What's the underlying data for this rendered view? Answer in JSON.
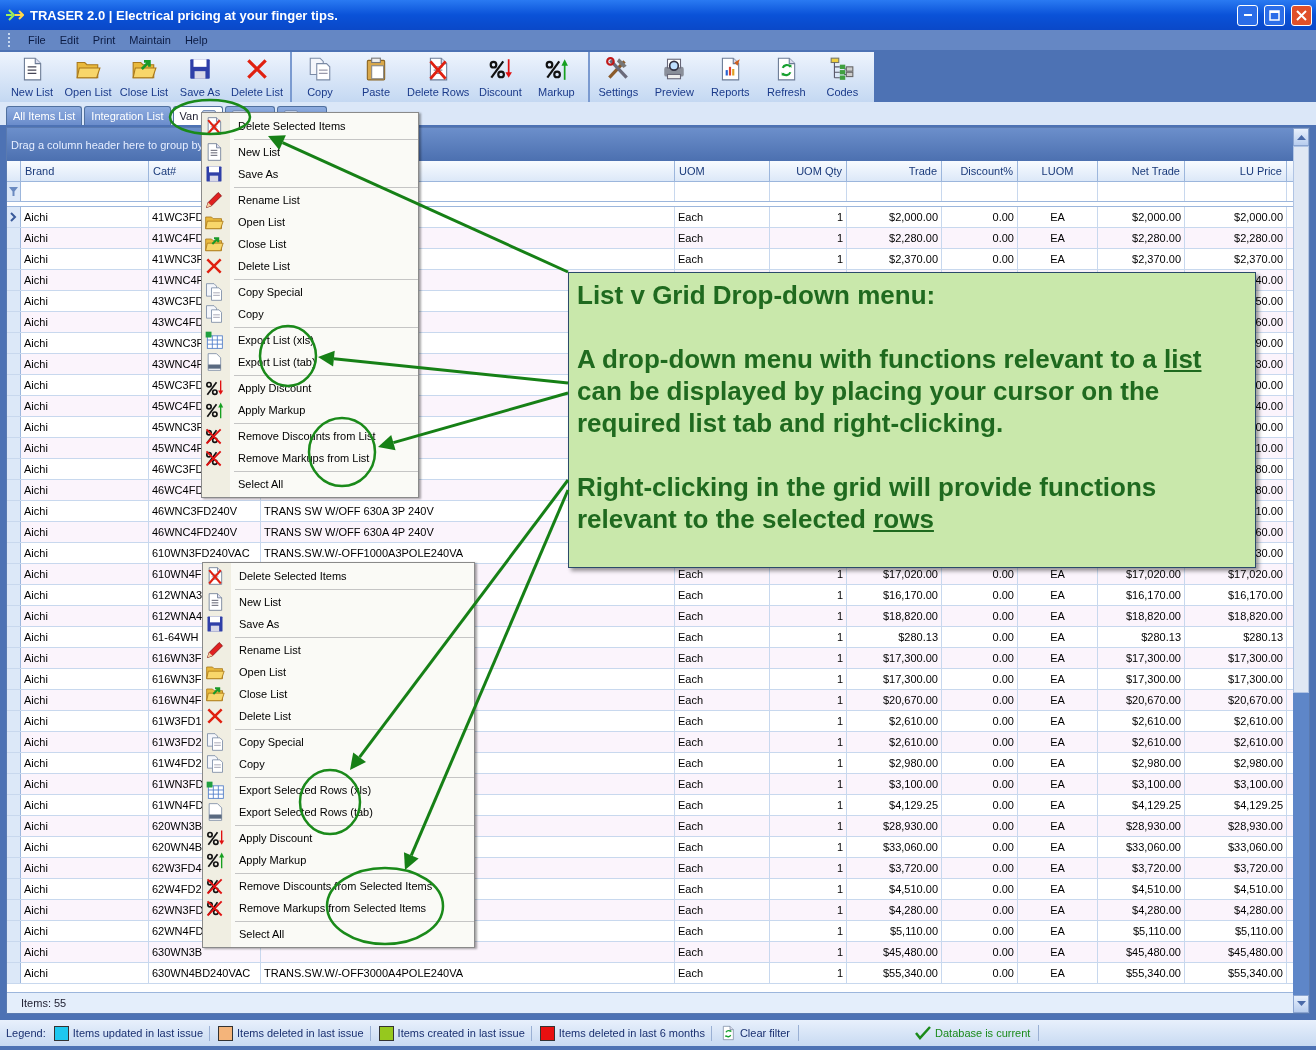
{
  "window": {
    "title": "TRASER 2.0 | Electrical pricing at your finger tips."
  },
  "menu_bar": [
    "File",
    "Edit",
    "Print",
    "Maintain",
    "Help"
  ],
  "toolbar": {
    "groups": [
      [
        {
          "label": "New List",
          "kind": "new"
        },
        {
          "label": "Open List",
          "kind": "open"
        },
        {
          "label": "Close List",
          "kind": "close"
        },
        {
          "label": "Save As",
          "kind": "save"
        },
        {
          "label": "Delete List",
          "kind": "delete"
        }
      ],
      [
        {
          "label": "Copy",
          "kind": "copy"
        },
        {
          "label": "Paste",
          "kind": "paste"
        },
        {
          "label": "Delete Rows",
          "kind": "delete-rows"
        },
        {
          "label": "Discount",
          "kind": "discount"
        },
        {
          "label": "Markup",
          "kind": "markup"
        }
      ],
      [
        {
          "label": "Settings",
          "kind": "settings"
        },
        {
          "label": "Preview",
          "kind": "preview"
        },
        {
          "label": "Reports",
          "kind": "reports"
        },
        {
          "label": "Refresh",
          "kind": "refresh"
        },
        {
          "label": "Codes",
          "kind": "codes"
        }
      ]
    ]
  },
  "tabs": [
    {
      "label": "All Items List",
      "selected": false,
      "closable": false
    },
    {
      "label": "Integration List",
      "selected": false,
      "closable": false
    },
    {
      "label": "Van",
      "selected": true,
      "closable": true
    },
    {
      "selected": false,
      "closable": true
    },
    {
      "selected": false,
      "closable": true
    }
  ],
  "grid": {
    "group_by_hint": "Drag a column header here to group by",
    "columns": [
      {
        "label": "Brand"
      },
      {
        "label": "Cat#"
      },
      {},
      {
        "label": "UOM"
      },
      {
        "label": "UOM Qty"
      },
      {
        "label": "Trade"
      },
      {
        "label": "Discount%"
      },
      {
        "label": "LUOM"
      },
      {
        "label": "Net Trade"
      },
      {
        "label": "LU Price"
      }
    ],
    "rows": [
      {
        "current": true,
        "brand": "Aichi",
        "cat_no": "41WC3FD",
        "uom": "Each",
        "uom_qty": "1",
        "trade": "$2,000.00",
        "discount_pct": "0.00",
        "luom": "EA",
        "net_trade": "$2,000.00",
        "lu_price": "$2,000.00"
      },
      {
        "current": false,
        "brand": "Aichi",
        "cat_no": "41WC4FD",
        "uom": "Each",
        "uom_qty": "1",
        "trade": "$2,280.00",
        "discount_pct": "0.00",
        "luom": "EA",
        "net_trade": "$2,280.00",
        "lu_price": "$2,280.00"
      },
      {
        "current": false,
        "brand": "Aichi",
        "cat_no": "41WNC3F",
        "uom": "Each",
        "uom_qty": "1",
        "trade": "$2,370.00",
        "discount_pct": "0.00",
        "luom": "EA",
        "net_trade": "$2,370.00",
        "lu_price": "$2,370.00"
      },
      {
        "current": false,
        "brand": "Aichi",
        "cat_no": "41WNC4F",
        "lu_price": "40.00"
      },
      {
        "current": false,
        "brand": "Aichi",
        "cat_no": "43WC3FD",
        "lu_price": "50.00"
      },
      {
        "current": false,
        "brand": "Aichi",
        "cat_no": "43WC4FD",
        "lu_price": "60.00"
      },
      {
        "current": false,
        "brand": "Aichi",
        "cat_no": "43WNC3F",
        "lu_price": "90.00"
      },
      {
        "current": false,
        "brand": "Aichi",
        "cat_no": "43WNC4F",
        "lu_price": "30.00"
      },
      {
        "current": false,
        "brand": "Aichi",
        "cat_no": "45WC3FD",
        "lu_price": "00.00"
      },
      {
        "current": false,
        "brand": "Aichi",
        "cat_no": "45WC4FD",
        "lu_price": "40.00"
      },
      {
        "current": false,
        "brand": "Aichi",
        "cat_no": "45WNC3F",
        "lu_price": "00.00"
      },
      {
        "current": false,
        "brand": "Aichi",
        "cat_no": "45WNC4F",
        "lu_price": "10.00"
      },
      {
        "current": false,
        "brand": "Aichi",
        "cat_no": "46WC3FD",
        "lu_price": "80.00"
      },
      {
        "current": false,
        "brand": "Aichi",
        "cat_no": "46WC4FD",
        "lu_price": "80.00"
      },
      {
        "current": false,
        "brand": "Aichi",
        "cat_no": "46WNC3FD240V",
        "column_3": "TRANS SW W/OFF 630A 3P 240V",
        "lu_price": "10.00"
      },
      {
        "current": false,
        "brand": "Aichi",
        "cat_no": "46WNC4FD240V",
        "column_3": "TRANS SW W/OFF 630A 4P 240V",
        "lu_price": "60.00"
      },
      {
        "current": false,
        "brand": "Aichi",
        "cat_no": "610WN3FD240VAC",
        "column_3": "TRANS.SW.W/-OFF1000A3POLE240VA",
        "lu_price": "30.00"
      },
      {
        "current": false,
        "brand": "Aichi",
        "cat_no": "610WN4F",
        "uom": "Each",
        "uom_qty": "1",
        "trade": "$17,020.00",
        "discount_pct": "0.00",
        "luom": "EA",
        "net_trade": "$17,020.00",
        "lu_price": "$17,020.00"
      },
      {
        "current": false,
        "brand": "Aichi",
        "cat_no": "612WNA3",
        "uom": "Each",
        "uom_qty": "1",
        "trade": "$16,170.00",
        "discount_pct": "0.00",
        "luom": "EA",
        "net_trade": "$16,170.00",
        "lu_price": "$16,170.00"
      },
      {
        "current": false,
        "brand": "Aichi",
        "cat_no": "612WNA4",
        "uom": "Each",
        "uom_qty": "1",
        "trade": "$18,820.00",
        "discount_pct": "0.00",
        "luom": "EA",
        "net_trade": "$18,820.00",
        "lu_price": "$18,820.00"
      },
      {
        "current": false,
        "brand": "Aichi",
        "cat_no": "61-64WH",
        "uom": "Each",
        "uom_qty": "1",
        "trade": "$280.13",
        "discount_pct": "0.00",
        "luom": "EA",
        "net_trade": "$280.13",
        "lu_price": "$280.13"
      },
      {
        "current": false,
        "brand": "Aichi",
        "cat_no": "616WN3F",
        "uom": "Each",
        "uom_qty": "1",
        "trade": "$17,300.00",
        "discount_pct": "0.00",
        "luom": "EA",
        "net_trade": "$17,300.00",
        "lu_price": "$17,300.00"
      },
      {
        "current": false,
        "brand": "Aichi",
        "cat_no": "616WN3F",
        "uom": "Each",
        "uom_qty": "1",
        "trade": "$17,300.00",
        "discount_pct": "0.00",
        "luom": "EA",
        "net_trade": "$17,300.00",
        "lu_price": "$17,300.00"
      },
      {
        "current": false,
        "brand": "Aichi",
        "cat_no": "616WN4F",
        "uom": "Each",
        "uom_qty": "1",
        "trade": "$20,670.00",
        "discount_pct": "0.00",
        "luom": "EA",
        "net_trade": "$20,670.00",
        "lu_price": "$20,670.00"
      },
      {
        "current": false,
        "brand": "Aichi",
        "cat_no": "61W3FD1",
        "uom": "Each",
        "uom_qty": "1",
        "trade": "$2,610.00",
        "discount_pct": "0.00",
        "luom": "EA",
        "net_trade": "$2,610.00",
        "lu_price": "$2,610.00"
      },
      {
        "current": false,
        "brand": "Aichi",
        "cat_no": "61W3FD2",
        "uom": "Each",
        "uom_qty": "1",
        "trade": "$2,610.00",
        "discount_pct": "0.00",
        "luom": "EA",
        "net_trade": "$2,610.00",
        "lu_price": "$2,610.00"
      },
      {
        "current": false,
        "brand": "Aichi",
        "cat_no": "61W4FD2",
        "uom": "Each",
        "uom_qty": "1",
        "trade": "$2,980.00",
        "discount_pct": "0.00",
        "luom": "EA",
        "net_trade": "$2,980.00",
        "lu_price": "$2,980.00"
      },
      {
        "current": false,
        "brand": "Aichi",
        "cat_no": "61WN3FD",
        "uom": "Each",
        "uom_qty": "1",
        "trade": "$3,100.00",
        "discount_pct": "0.00",
        "luom": "EA",
        "net_trade": "$3,100.00",
        "lu_price": "$3,100.00"
      },
      {
        "current": false,
        "brand": "Aichi",
        "cat_no": "61WN4FD",
        "uom": "Each",
        "uom_qty": "1",
        "trade": "$4,129.25",
        "discount_pct": "0.00",
        "luom": "EA",
        "net_trade": "$4,129.25",
        "lu_price": "$4,129.25"
      },
      {
        "current": false,
        "brand": "Aichi",
        "cat_no": "620WN3B",
        "uom": "Each",
        "uom_qty": "1",
        "trade": "$28,930.00",
        "discount_pct": "0.00",
        "luom": "EA",
        "net_trade": "$28,930.00",
        "lu_price": "$28,930.00"
      },
      {
        "current": false,
        "brand": "Aichi",
        "cat_no": "620WN4B",
        "uom": "Each",
        "uom_qty": "1",
        "trade": "$33,060.00",
        "discount_pct": "0.00",
        "luom": "EA",
        "net_trade": "$33,060.00",
        "lu_price": "$33,060.00"
      },
      {
        "current": false,
        "brand": "Aichi",
        "cat_no": "62W3FD4",
        "uom": "Each",
        "uom_qty": "1",
        "trade": "$3,720.00",
        "discount_pct": "0.00",
        "luom": "EA",
        "net_trade": "$3,720.00",
        "lu_price": "$3,720.00"
      },
      {
        "current": false,
        "brand": "Aichi",
        "cat_no": "62W4FD2",
        "uom": "Each",
        "uom_qty": "1",
        "trade": "$4,510.00",
        "discount_pct": "0.00",
        "luom": "EA",
        "net_trade": "$4,510.00",
        "lu_price": "$4,510.00"
      },
      {
        "current": false,
        "brand": "Aichi",
        "cat_no": "62WN3FD",
        "uom": "Each",
        "uom_qty": "1",
        "trade": "$4,280.00",
        "discount_pct": "0.00",
        "luom": "EA",
        "net_trade": "$4,280.00",
        "lu_price": "$4,280.00"
      },
      {
        "current": false,
        "brand": "Aichi",
        "cat_no": "62WN4FD",
        "uom": "Each",
        "uom_qty": "1",
        "trade": "$5,110.00",
        "discount_pct": "0.00",
        "luom": "EA",
        "net_trade": "$5,110.00",
        "lu_price": "$5,110.00"
      },
      {
        "current": false,
        "brand": "Aichi",
        "cat_no": "630WN3B",
        "uom": "Each",
        "uom_qty": "1",
        "trade": "$45,480.00",
        "discount_pct": "0.00",
        "luom": "EA",
        "net_trade": "$45,480.00",
        "lu_price": "$45,480.00"
      },
      {
        "current": false,
        "brand": "Aichi",
        "cat_no": "630WN4BD240VAC",
        "column_3": "TRANS.SW.W/-OFF3000A4POLE240VA",
        "uom": "Each",
        "uom_qty": "1",
        "trade": "$55,340.00",
        "discount_pct": "0.00",
        "luom": "EA",
        "net_trade": "$55,340.00",
        "lu_price": "$55,340.00"
      }
    ],
    "footer": "Items: 55"
  },
  "list_menu": [
    {
      "kind": "delete-items",
      "label": "Delete Selected Items"
    },
    {
      "kind": "separator"
    },
    {
      "kind": "new",
      "label": "New List"
    },
    {
      "kind": "save",
      "label": "Save As"
    },
    {
      "kind": "separator"
    },
    {
      "kind": "rename",
      "label": "Rename List"
    },
    {
      "kind": "open",
      "label": "Open List"
    },
    {
      "kind": "close",
      "label": "Close List"
    },
    {
      "kind": "delete",
      "label": "Delete List"
    },
    {
      "kind": "separator"
    },
    {
      "kind": "copy",
      "label": "Copy Special"
    },
    {
      "kind": "copy",
      "label": "Copy"
    },
    {
      "kind": "separator"
    },
    {
      "kind": "export-xls",
      "label": "Export List (xls)"
    },
    {
      "kind": "export-tab",
      "label": "Export List (tab)"
    },
    {
      "kind": "separator"
    },
    {
      "kind": "discount",
      "label": "Apply Discount"
    },
    {
      "kind": "markup",
      "label": "Apply Markup"
    },
    {
      "kind": "separator"
    },
    {
      "kind": "remove-discount",
      "label": "Remove Discounts from List"
    },
    {
      "kind": "remove-markup",
      "label": "Remove Markups from List"
    },
    {
      "kind": "separator"
    },
    {
      "kind": "plain",
      "label": "Select All"
    }
  ],
  "grid_menu": [
    {
      "kind": "delete-items",
      "label": "Delete Selected Items"
    },
    {
      "kind": "separator"
    },
    {
      "kind": "new",
      "label": "New List"
    },
    {
      "kind": "save",
      "label": "Save As"
    },
    {
      "kind": "separator"
    },
    {
      "kind": "rename",
      "label": "Rename List"
    },
    {
      "kind": "open",
      "label": "Open List"
    },
    {
      "kind": "close",
      "label": "Close List"
    },
    {
      "kind": "delete",
      "label": "Delete List"
    },
    {
      "kind": "separator"
    },
    {
      "kind": "copy",
      "label": "Copy Special"
    },
    {
      "kind": "copy",
      "label": "Copy"
    },
    {
      "kind": "separator"
    },
    {
      "kind": "export-xls",
      "label": "Export Selected Rows (xls)"
    },
    {
      "kind": "export-tab",
      "label": "Export Selected Rows (tab)"
    },
    {
      "kind": "separator"
    },
    {
      "kind": "discount",
      "label": "Apply Discount"
    },
    {
      "kind": "markup",
      "label": "Apply Markup"
    },
    {
      "kind": "separator"
    },
    {
      "kind": "remove-discount",
      "label": "Remove Discounts from Selected Items"
    },
    {
      "kind": "remove-markup",
      "label": "Remove Markups from Selected Items"
    },
    {
      "kind": "separator"
    },
    {
      "kind": "plain",
      "label": "Select All"
    }
  ],
  "callout": {
    "title": "List v Grid Drop-down menu:",
    "paragraphs": [
      [
        {
          "text": "A drop-down menu with functions relevant to a ",
          "underline": false
        },
        {
          "text": "list",
          "underline": true
        },
        {
          "text": " can be displayed by placing your cursor on the required list tab and right-clicking.",
          "underline": false
        }
      ],
      [
        {
          "text": "Right-clicking in the grid will provide functions relevant to the selected ",
          "underline": false
        },
        {
          "text": "rows",
          "underline": true
        }
      ]
    ]
  },
  "status_bar": {
    "legend_label": "Legend:",
    "legend": [
      {
        "label": "Items updated in last issue",
        "color": "#1ec8f0"
      },
      {
        "label": "Items deleted in last issue",
        "color": "#f4b47a"
      },
      {
        "label": "Items created in last issue",
        "color": "#96c81e"
      },
      {
        "label": "Items deleted in last 6 months",
        "color": "#e81010"
      }
    ],
    "clear_filter": "Clear filter",
    "database_status": "Database is current"
  }
}
